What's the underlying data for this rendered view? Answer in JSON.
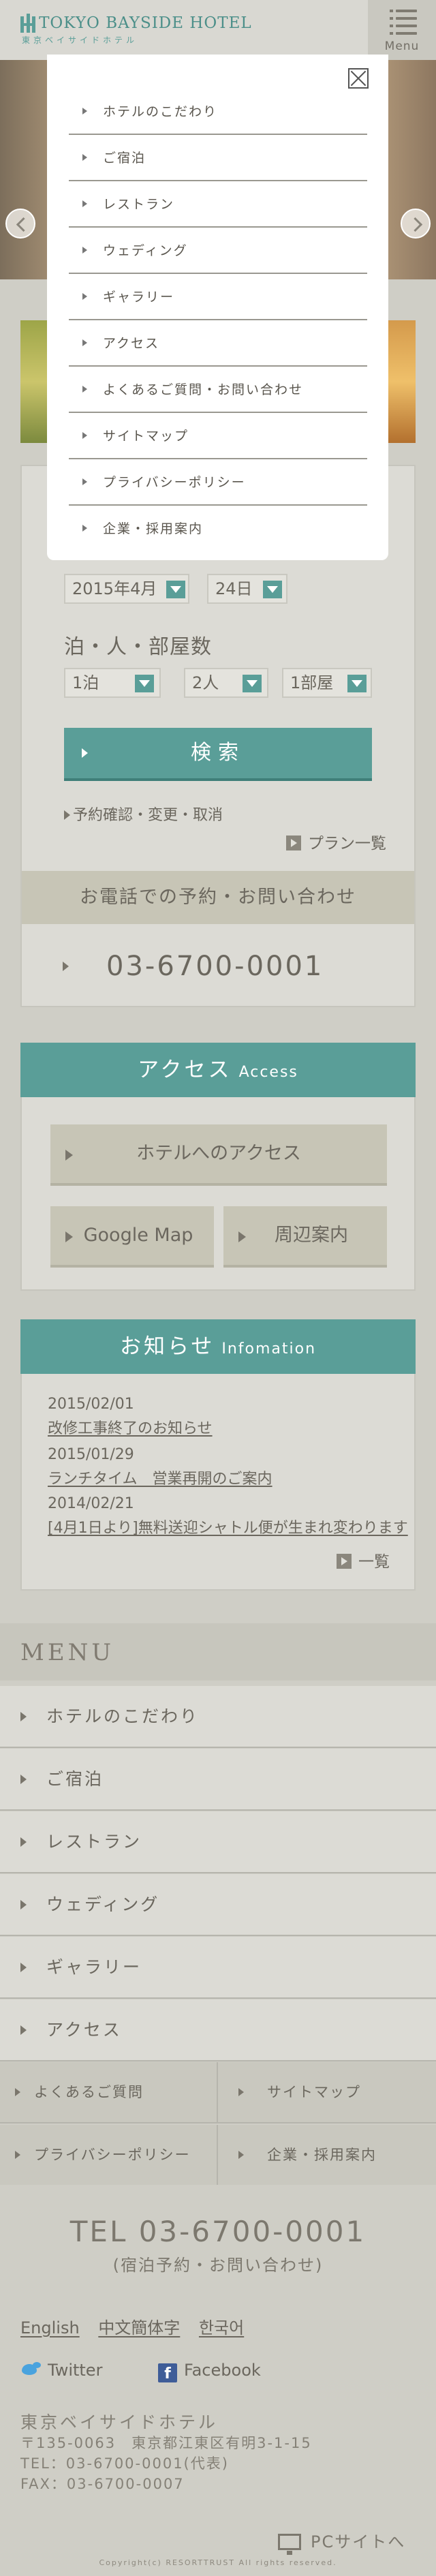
{
  "header": {
    "logo_main": "TOKYO BAYSIDE HOTEL",
    "logo_sub": "東京ベイサイドホテル",
    "menu_label": "Menu"
  },
  "booking": {
    "date_month": "2015年4月",
    "date_day": "24日",
    "guests_label": "泊・人・部屋数",
    "nights": "1泊",
    "people": "2人",
    "rooms": "1部屋",
    "search_label": "検索",
    "confirm_link": "予約確認・変更・取消",
    "plan_link": "プラン一覧",
    "tel_heading": "お電話での予約・お問い合わせ",
    "tel_number": "03-6700-0001"
  },
  "access": {
    "title_jp": "アクセス",
    "title_en": "Access",
    "hotel_access": "ホテルへのアクセス",
    "google_map": "Google Map",
    "nearby": "周辺案内"
  },
  "news": {
    "title_jp": "お知らせ",
    "title_en": "Infomation",
    "items": [
      {
        "date": "2015/02/01",
        "title": "改修工事終了のお知らせ"
      },
      {
        "date": "2015/01/29",
        "title": "ランチタイム　営業再開のご案内"
      },
      {
        "date": "2014/02/21",
        "title": "[4月1日より]無料送迎シャトル便が生まれ変わります"
      }
    ],
    "more_link": "一覧"
  },
  "menu": {
    "heading": "MENU",
    "items": [
      "ホテルのこだわり",
      "ご宿泊",
      "レストラン",
      "ウェディング",
      "ギャラリー",
      "アクセス"
    ],
    "sub_items": [
      "よくあるご質問",
      "サイトマップ",
      "プライバシーポリシー",
      "企業・採用案内"
    ]
  },
  "footer": {
    "tel": "TEL  03-6700-0001",
    "tel_note": "(宿泊予約・お問い合わせ)",
    "languages": [
      "English",
      "中文簡体字",
      "한국어"
    ],
    "twitter": "Twitter",
    "facebook": "Facebook",
    "hotel_name": "東京ベイサイドホテル",
    "address": "〒135-0063　東京都江東区有明3-1-15",
    "tel_line": "TEL：03-6700-0001(代表)",
    "fax_line": "FAX：03-6700-0007",
    "pc_link": "PCサイトへ",
    "copyright": "Copyright(c) RESORTTRUST All rights reserved."
  },
  "drawer": {
    "items": [
      "ホテルのこだわり",
      "ご宿泊",
      "レストラン",
      "ウェディング",
      "ギャラリー",
      "アクセス",
      "よくあるご質問・お問い合わせ",
      "サイトマップ",
      "プライバシーポリシー",
      "企業・採用案内"
    ]
  },
  "colors": {
    "accent": "#5a9e98",
    "background": "#cfcec6",
    "card": "#dcdbd5",
    "text": "#6b675e"
  }
}
